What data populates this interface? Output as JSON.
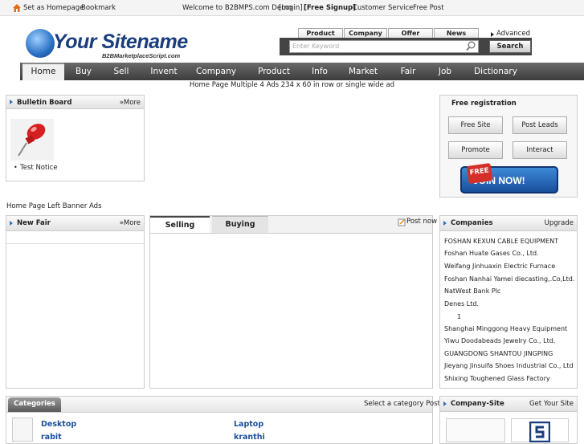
{
  "topbar": {
    "set_homepage": "Set as Homepage",
    "bookmark": "Bookmark",
    "welcome": "Welcome to B2BMPS.com Demo",
    "login": "[Login]",
    "signup": "[Free Signup]",
    "customer_service": "Customer Service",
    "free_post": "Free Post"
  },
  "logo": {
    "text": "Your Sitename",
    "subtitle": "B2BMarketplaceScript.com"
  },
  "search": {
    "tabs": [
      "Product",
      "Company",
      "Offer",
      "News"
    ],
    "advanced": "Advanced",
    "placeholder": "Enter Keyword",
    "button": "Search"
  },
  "nav": [
    "Home",
    "Buy",
    "Sell",
    "Invent",
    "Company",
    "Product",
    "Info",
    "Market",
    "Fair",
    "Job",
    "Dictionary"
  ],
  "ad_text": "Home Page Multiple 4 Ads 234 x 60 in row or single wide ad",
  "bulletin": {
    "title": "Bulletin Board",
    "more": "More",
    "notice": "Test Notice"
  },
  "registration": {
    "title": "Free registration",
    "buttons": [
      "Free Site",
      "Post Leads",
      "Promote",
      "Interact"
    ],
    "join_badge": "FREE",
    "join_text": "JOIN NOW!"
  },
  "left_banner": "Home Page Left Banner Ads",
  "new_fair": {
    "title": "New Fair",
    "more": "More"
  },
  "trade_tabs": {
    "selling": "Selling",
    "buying": "Buying",
    "post_now": "Post now"
  },
  "companies": {
    "title": "Companies",
    "upgrade": "Upgrade",
    "list": [
      "FOSHAN KEXUN CABLE EQUIPMENT",
      "Foshan Huate Gases Co., Ltd.",
      "Weifang Jinhuaxin Electric Furnace",
      "Foshan Nanhai Yamei diecasting,.Co,Ltd.",
      "NatWest Bank Plc",
      "Denes Ltd.",
      "1",
      "Shanghai Minggong Heavy Equipment",
      "Yiwu Doodabeads Jewelry Co., Ltd.",
      "GUANGDONG SHANTOU JINGPING",
      "Jieyang Jinsuifa Shoes Industrial Co., Ltd",
      "Shixing Toughened Glass Factory"
    ]
  },
  "categories": {
    "title": "Categories",
    "select_post": "Select a category Post",
    "items": [
      "Desktop",
      "Laptop"
    ],
    "items_partial": [
      "rabit",
      "kranthi"
    ]
  },
  "company_site": {
    "title": "Company-Site",
    "link": "Get Your Site"
  },
  "colors": {
    "nav_dark": "#3c3c3c",
    "link_blue": "#1a4f9c",
    "accent_blue": "#3a6fb5",
    "join_red": "#d4302a"
  }
}
